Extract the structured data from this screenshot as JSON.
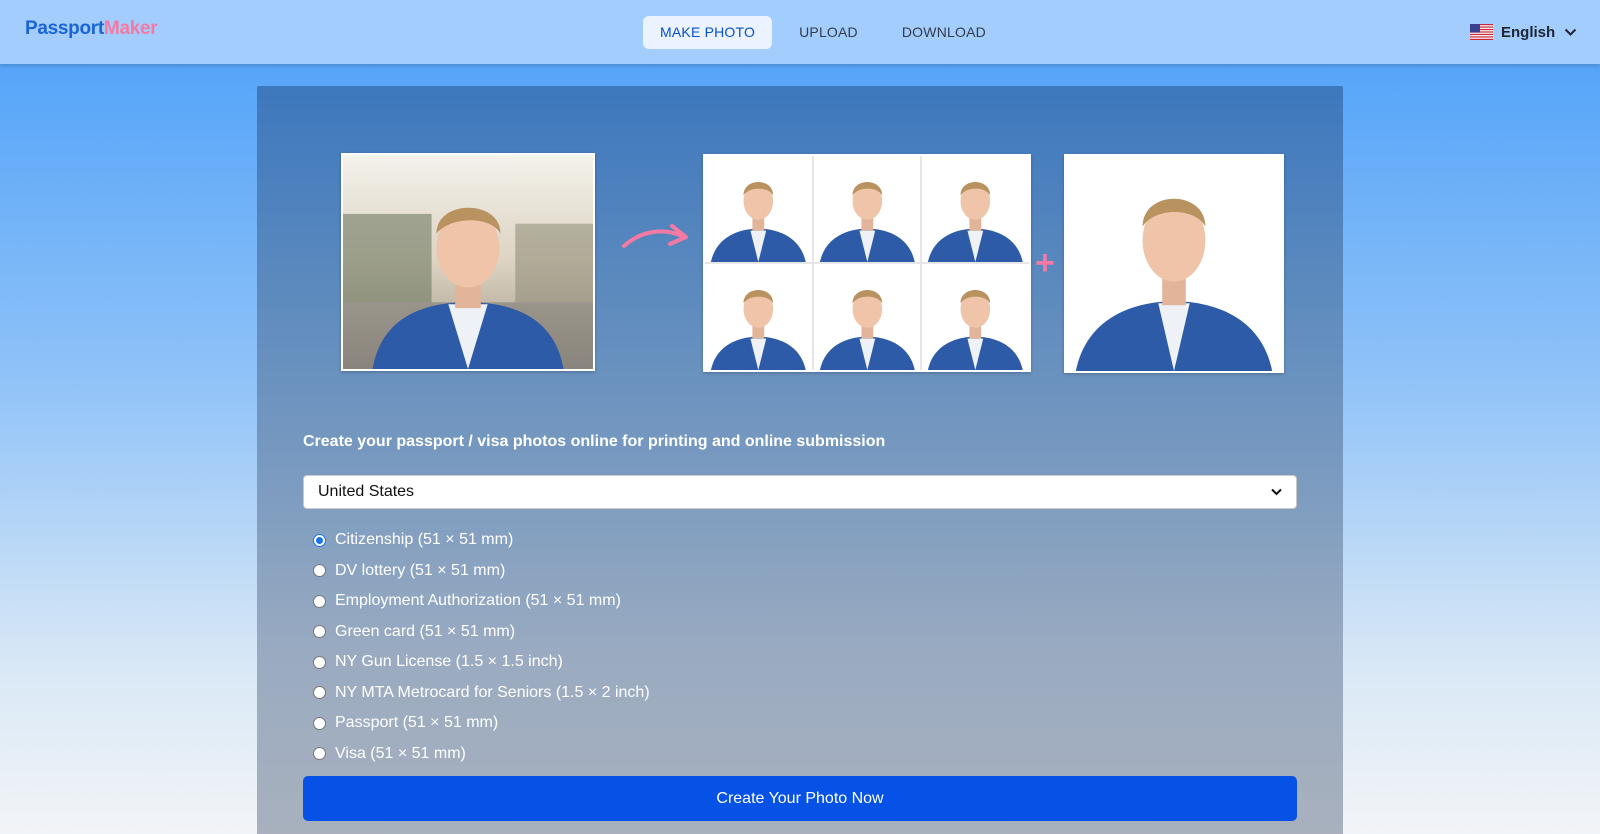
{
  "header": {
    "logo_part1": "Passport",
    "logo_part2": "Maker",
    "nav": [
      {
        "label": "MAKE PHOTO",
        "active": true
      },
      {
        "label": "UPLOAD",
        "active": false
      },
      {
        "label": "DOWNLOAD",
        "active": false
      }
    ],
    "language": "English",
    "language_flag": "us-flag-icon"
  },
  "hero": {
    "plus_symbol": "+"
  },
  "form": {
    "tagline": "Create your passport / visa photos online for printing and online submission",
    "country_selected": "United States",
    "document_types": [
      {
        "label": "Citizenship (51 × 51 mm)",
        "checked": true
      },
      {
        "label": "DV lottery (51 × 51 mm)",
        "checked": false
      },
      {
        "label": "Employment Authorization (51 × 51 mm)",
        "checked": false
      },
      {
        "label": "Green card (51 × 51 mm)",
        "checked": false
      },
      {
        "label": "NY Gun License (1.5 × 1.5 inch)",
        "checked": false
      },
      {
        "label": "NY MTA Metrocard for Seniors (1.5 × 2 inch)",
        "checked": false
      },
      {
        "label": "Passport (51 × 51 mm)",
        "checked": false
      },
      {
        "label": "Visa (51 × 51 mm)",
        "checked": false
      }
    ],
    "cta_label": "Create Your Photo Now"
  },
  "colors": {
    "brand_blue": "#1a64d6",
    "brand_pink": "#f47aa3",
    "cta_blue": "#0651e6"
  }
}
